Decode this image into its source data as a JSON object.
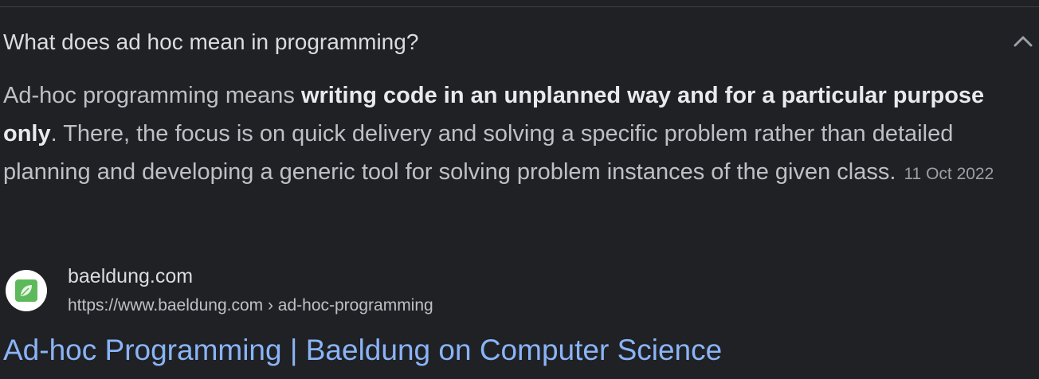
{
  "question": {
    "text": "What does ad hoc mean in programming?",
    "chevron_icon": "chevron-up-icon"
  },
  "answer": {
    "intro": "Ad-hoc programming means ",
    "bold": "writing code in an unplanned way and for a particular purpose only",
    "rest": ". There, the focus is on quick delivery and solving a specific problem rather than detailed planning and developing a generic tool for solving problem instances of the given class.",
    "date": "11 Oct 2022"
  },
  "source": {
    "site_name": "baeldung.com",
    "url": "https://www.baeldung.com › ad-hoc-programming",
    "favicon_icon": "baeldung-leaf-icon",
    "favicon_color": "#5eb95a"
  },
  "result": {
    "title": "Ad-hoc Programming | Baeldung on Computer Science"
  },
  "colors": {
    "background": "#202124",
    "text": "#bdc1c6",
    "link": "#8ab4f8"
  }
}
